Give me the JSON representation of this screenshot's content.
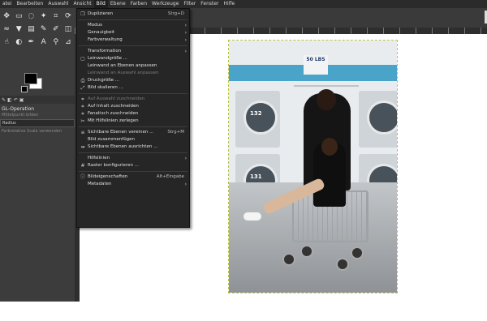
{
  "menubar": {
    "items": [
      "atei",
      "Bearbeiten",
      "Auswahl",
      "Ansicht",
      "Bild",
      "Ebene",
      "Farben",
      "Werkzeuge",
      "Filter",
      "Fenster",
      "Hilfe"
    ],
    "active": "Bild"
  },
  "toolbox": {
    "tool_icons": [
      "move-icon",
      "rect-select-icon",
      "lasso-icon",
      "fuzzy-select-icon",
      "crop-icon",
      "transform-icon",
      "warp-icon",
      "fill-icon",
      "gradient-icon",
      "paint-icon",
      "brush-icon",
      "eraser-icon",
      "smudge-icon",
      "dodge-icon",
      "path-icon",
      "text-icon",
      "zoom-icon",
      "measure-icon"
    ],
    "options_header": "GL-Operation",
    "options_sub": "Mittelpunkt bilden",
    "options_select": "Radius",
    "options_button": "Farbrelative Scala verwenden"
  },
  "image_menu": {
    "items": [
      {
        "icon": "duplicate-icon",
        "label": "Duplizieren",
        "shortcut": "Strg+D",
        "submenu": false,
        "disabled": false
      },
      {
        "sep": true
      },
      {
        "icon": "",
        "label": "Modus",
        "shortcut": "",
        "submenu": true,
        "disabled": false
      },
      {
        "icon": "",
        "label": "Genauigkeit",
        "shortcut": "",
        "submenu": true,
        "disabled": false
      },
      {
        "icon": "",
        "label": "Farbverwaltung",
        "shortcut": "",
        "submenu": true,
        "disabled": false
      },
      {
        "sep": true
      },
      {
        "icon": "",
        "label": "Transformation",
        "shortcut": "",
        "submenu": true,
        "disabled": false
      },
      {
        "icon": "canvas-size-icon",
        "label": "Leinwandgröße ...",
        "shortcut": "",
        "submenu": false,
        "disabled": false
      },
      {
        "icon": "",
        "label": "Leinwand an Ebenen anpassen",
        "shortcut": "",
        "submenu": false,
        "disabled": false
      },
      {
        "icon": "",
        "label": "Leinwand an Auswahl anpassen",
        "shortcut": "",
        "submenu": false,
        "disabled": true
      },
      {
        "icon": "print-size-icon",
        "label": "Druckgröße ...",
        "shortcut": "",
        "submenu": false,
        "disabled": false
      },
      {
        "icon": "scale-icon",
        "label": "Bild skalieren ...",
        "shortcut": "",
        "submenu": false,
        "disabled": false
      },
      {
        "sep": true
      },
      {
        "icon": "crop-icon",
        "label": "Auf Auswahl zuschneiden",
        "shortcut": "",
        "submenu": false,
        "disabled": true
      },
      {
        "icon": "crop-icon",
        "label": "Auf Inhalt zuschneiden",
        "shortcut": "",
        "submenu": false,
        "disabled": false
      },
      {
        "icon": "crop-icon",
        "label": "Fanatisch zuschneiden",
        "shortcut": "",
        "submenu": false,
        "disabled": false
      },
      {
        "icon": "guides-icon",
        "label": "Mit Hilfslinien zerlegen",
        "shortcut": "",
        "submenu": false,
        "disabled": false
      },
      {
        "sep": true
      },
      {
        "icon": "merge-icon",
        "label": "Sichtbare Ebenen vereinen ...",
        "shortcut": "Strg+M",
        "submenu": false,
        "disabled": false
      },
      {
        "icon": "",
        "label": "Bild zusammenfügen",
        "shortcut": "",
        "submenu": false,
        "disabled": false
      },
      {
        "icon": "align-icon",
        "label": "Sichtbare Ebenen ausrichten ...",
        "shortcut": "",
        "submenu": false,
        "disabled": false
      },
      {
        "sep": true
      },
      {
        "icon": "",
        "label": "Hilfslinien",
        "shortcut": "",
        "submenu": true,
        "disabled": false
      },
      {
        "icon": "grid-icon",
        "label": "Raster konfigurieren ...",
        "shortcut": "",
        "submenu": false,
        "disabled": false
      },
      {
        "sep": true
      },
      {
        "icon": "properties-icon",
        "label": "Bildeigenschaften",
        "shortcut": "Alt+Eingabe",
        "submenu": false,
        "disabled": false
      },
      {
        "icon": "",
        "label": "Metadaten",
        "shortcut": "",
        "submenu": true,
        "disabled": false
      }
    ]
  },
  "photo": {
    "sign_text": "50 LBS",
    "washer_numbers": [
      "132",
      "131"
    ]
  },
  "colors": {
    "menu_bg": "#262626",
    "app_bg": "#454545",
    "canvas_bg": "#ffffff",
    "accent_blue": "#4aa4c9"
  }
}
